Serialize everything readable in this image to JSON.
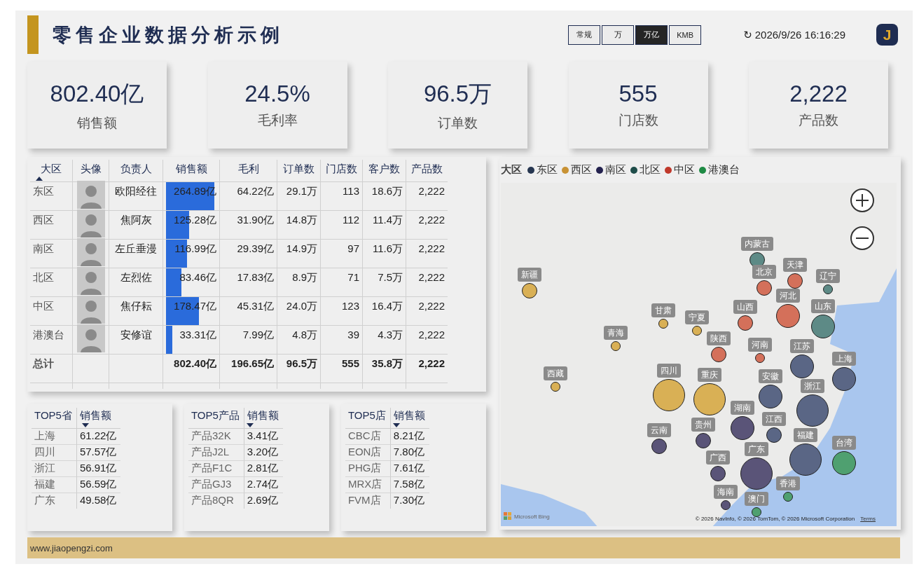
{
  "header": {
    "title": "零售企业数据分析示例",
    "unit_buttons": [
      {
        "label": "常规",
        "selected": false
      },
      {
        "label": "万",
        "selected": false
      },
      {
        "label": "万亿",
        "selected": true
      },
      {
        "label": "KMB",
        "selected": false
      }
    ],
    "refresh_icon": "↻",
    "timestamp": "2026/9/26 16:16:29",
    "logo": "J"
  },
  "kpis": [
    {
      "value": "802.40亿",
      "label": "销售额"
    },
    {
      "value": "24.5%",
      "label": "毛利率"
    },
    {
      "value": "96.5万",
      "label": "订单数"
    },
    {
      "value": "555",
      "label": "门店数"
    },
    {
      "value": "2,222",
      "label": "产品数"
    }
  ],
  "table": {
    "columns": [
      {
        "label": "大区",
        "sorted_ascending": true
      },
      {
        "label": "头像"
      },
      {
        "label": "负责人"
      },
      {
        "label": "销售额"
      },
      {
        "label": "毛利"
      },
      {
        "label": "订单数"
      },
      {
        "label": "门店数"
      },
      {
        "label": "客户数"
      },
      {
        "label": "产品数"
      }
    ],
    "rows": [
      {
        "region": "东区",
        "manager": "欧阳经往",
        "sales": "264.89亿",
        "level": 1,
        "profit": "64.22亿",
        "orders": "29.1万",
        "stores": "113",
        "customers": "18.6万",
        "products": "2,222"
      },
      {
        "region": "西区",
        "manager": "焦阿灰",
        "sales": "125.28亿",
        "level": 0.473,
        "profit": "31.90亿",
        "orders": "14.8万",
        "stores": "112",
        "customers": "11.4万",
        "products": "2,222"
      },
      {
        "region": "南区",
        "manager": "左丘垂漫",
        "sales": "116.99亿",
        "level": 0.442,
        "profit": "29.39亿",
        "orders": "14.9万",
        "stores": "97",
        "customers": "11.6万",
        "products": "2,222"
      },
      {
        "region": "北区",
        "manager": "左烈佐",
        "sales": "83.46亿",
        "level": 0.315,
        "profit": "17.83亿",
        "orders": "8.9万",
        "stores": "71",
        "customers": "7.5万",
        "products": "2,222"
      },
      {
        "region": "中区",
        "manager": "焦仔耘",
        "sales": "178.47亿",
        "level": 0.674,
        "profit": "45.31亿",
        "orders": "24.0万",
        "stores": "123",
        "customers": "16.4万",
        "products": "2,222"
      },
      {
        "region": "港澳台",
        "manager": "安修谊",
        "sales": "33.31亿",
        "level": 0.126,
        "profit": "7.99亿",
        "orders": "4.8万",
        "stores": "39",
        "customers": "4.3万",
        "products": "2,222"
      }
    ],
    "total": {
      "label": "总计",
      "sales": "802.40亿",
      "profit": "196.65亿",
      "orders": "96.5万",
      "stores": "555",
      "customers": "35.8万",
      "products": "2,222"
    }
  },
  "top5": [
    {
      "columns": [
        {
          "label": "TOP5省"
        },
        {
          "label": "销售额",
          "sorted_descending": true
        }
      ],
      "rows": [
        [
          "上海",
          "61.22亿"
        ],
        [
          "四川",
          "57.57亿"
        ],
        [
          "浙江",
          "56.91亿"
        ],
        [
          "福建",
          "56.59亿"
        ],
        [
          "广东",
          "49.58亿"
        ]
      ]
    },
    {
      "columns": [
        {
          "label": "TOP5产品"
        },
        {
          "label": "销售额",
          "sorted_descending": true
        }
      ],
      "rows": [
        [
          "产品32K",
          "3.41亿"
        ],
        [
          "产品J2L",
          "3.20亿"
        ],
        [
          "产品F1C",
          "2.81亿"
        ],
        [
          "产品GJ3",
          "2.74亿"
        ],
        [
          "产品8QR",
          "2.69亿"
        ]
      ]
    },
    {
      "columns": [
        {
          "label": "TOP5店"
        },
        {
          "label": "销售额",
          "sorted_descending": true
        }
      ],
      "rows": [
        [
          "CBC店",
          "8.21亿"
        ],
        [
          "EON店",
          "7.80亿"
        ],
        [
          "PHG店",
          "7.61亿"
        ],
        [
          "MRX店",
          "7.58亿"
        ],
        [
          "FVM店",
          "7.30亿"
        ]
      ]
    }
  ],
  "map": {
    "legend_title": "大区",
    "legend": [
      {
        "label": "东区",
        "color": "#263650"
      },
      {
        "label": "西区",
        "color": "#c89234"
      },
      {
        "label": "南区",
        "color": "#24224f"
      },
      {
        "label": "北区",
        "color": "#1f4d4a"
      },
      {
        "label": "中区",
        "color": "#c0392b"
      },
      {
        "label": "港澳台",
        "color": "#1e8a44"
      }
    ],
    "markers": [
      {
        "label": "内蒙古",
        "color": "#5d8a86"
      },
      {
        "label": "天津",
        "color": "#d4705a"
      },
      {
        "label": "北京",
        "color": "#d4705a"
      },
      {
        "label": "新疆",
        "color": "#d9b055"
      },
      {
        "label": "辽宁",
        "color": "#5d8a86"
      },
      {
        "label": "河北",
        "color": "#d4705a"
      },
      {
        "label": "山东",
        "color": "#5d8a86"
      },
      {
        "label": "山西",
        "color": "#d4705a"
      },
      {
        "label": "甘肃",
        "color": "#d9b055"
      },
      {
        "label": "宁夏",
        "color": "#d9b055"
      },
      {
        "label": "青海",
        "color": "#d9b055"
      },
      {
        "label": "陕西",
        "color": "#d4705a"
      },
      {
        "label": "河南",
        "color": "#d4705a"
      },
      {
        "label": "江苏",
        "color": "#5a6685"
      },
      {
        "label": "上海",
        "color": "#5a6685"
      },
      {
        "label": "四川",
        "color": "#d9b055"
      },
      {
        "label": "西藏",
        "color": "#d9b055"
      },
      {
        "label": "重庆",
        "color": "#d9b055"
      },
      {
        "label": "安徽",
        "color": "#5a6685"
      },
      {
        "label": "浙江",
        "color": "#5a6685"
      },
      {
        "label": "湖南",
        "color": "#5a5478"
      },
      {
        "label": "江西",
        "color": "#5a6685"
      },
      {
        "label": "贵州",
        "color": "#5a5478"
      },
      {
        "label": "云南",
        "color": "#5a5478"
      },
      {
        "label": "福建",
        "color": "#5a6685"
      },
      {
        "label": "台湾",
        "color": "#4fa070"
      },
      {
        "label": "广东",
        "color": "#5a5478"
      },
      {
        "label": "广西",
        "color": "#5a5478"
      },
      {
        "label": "香港",
        "color": "#4fa070"
      },
      {
        "label": "海南",
        "color": "#5a5478"
      },
      {
        "label": "澳门",
        "color": "#4fa070"
      }
    ],
    "provider": "Microsoft Bing",
    "copyright": "© 2026 NavInfo, © 2026 TomTom, © 2026 Microsoft Corporation",
    "terms": "Terms"
  },
  "footer": {
    "text": "www.jiaopengzi.com"
  }
}
